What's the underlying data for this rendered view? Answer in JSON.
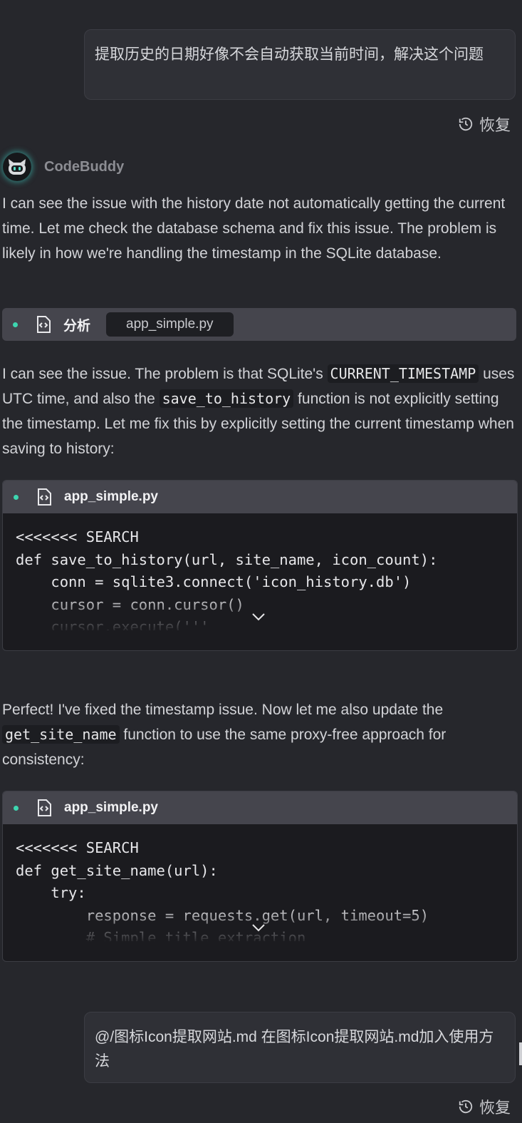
{
  "messages": {
    "user1": "提取历史的日期好像不会自动获取当前时间，解决这个问题",
    "restore_label": "恢复",
    "agent_name": "CodeBuddy",
    "intro": "I can see the issue with the history date not automatically getting the current time. Let me check the database schema and fix this issue. The problem is likely in how we're handling the timestamp in the SQLite database.",
    "analyze_label": "分析",
    "analyze_file": "app_simple.py",
    "para2_a": "I can see the issue. The problem is that SQLite's ",
    "para2_code1": "CURRENT_TIMESTAMP",
    "para2_b": " uses UTC time, and also the ",
    "para2_code2": "save_to_history",
    "para2_c": " function is not explicitly setting the timestamp. Let me fix this by explicitly setting the current timestamp when saving to history:",
    "edit1_file": "app_simple.py",
    "edit1_code": [
      "<<<<<<< SEARCH",
      "def save_to_history(url, site_name, icon_count):",
      "    conn = sqlite3.connect('icon_history.db')",
      "    cursor = conn.cursor()",
      "    cursor.execute('''"
    ],
    "para3_a": "Perfect! I've fixed the timestamp issue. Now let me also update the ",
    "para3_code": "get_site_name",
    "para3_b": " function to use the same proxy-free approach for consistency:",
    "edit2_file": "app_simple.py",
    "edit2_code": [
      "<<<<<<< SEARCH",
      "def get_site_name(url):",
      "    try:",
      "        response = requests.get(url, timeout=5)",
      "        # Simple title extraction"
    ],
    "user2": "@/图标Icon提取网站.md 在图标Icon提取网站.md加入使用方法"
  },
  "colors": {
    "accent_dot": "#3dd6b0",
    "background": "#26272c",
    "header_bar": "#45454d"
  },
  "icons": [
    "history-icon",
    "code-file-icon",
    "chevron-down-icon",
    "avatar-robot-icon"
  ]
}
